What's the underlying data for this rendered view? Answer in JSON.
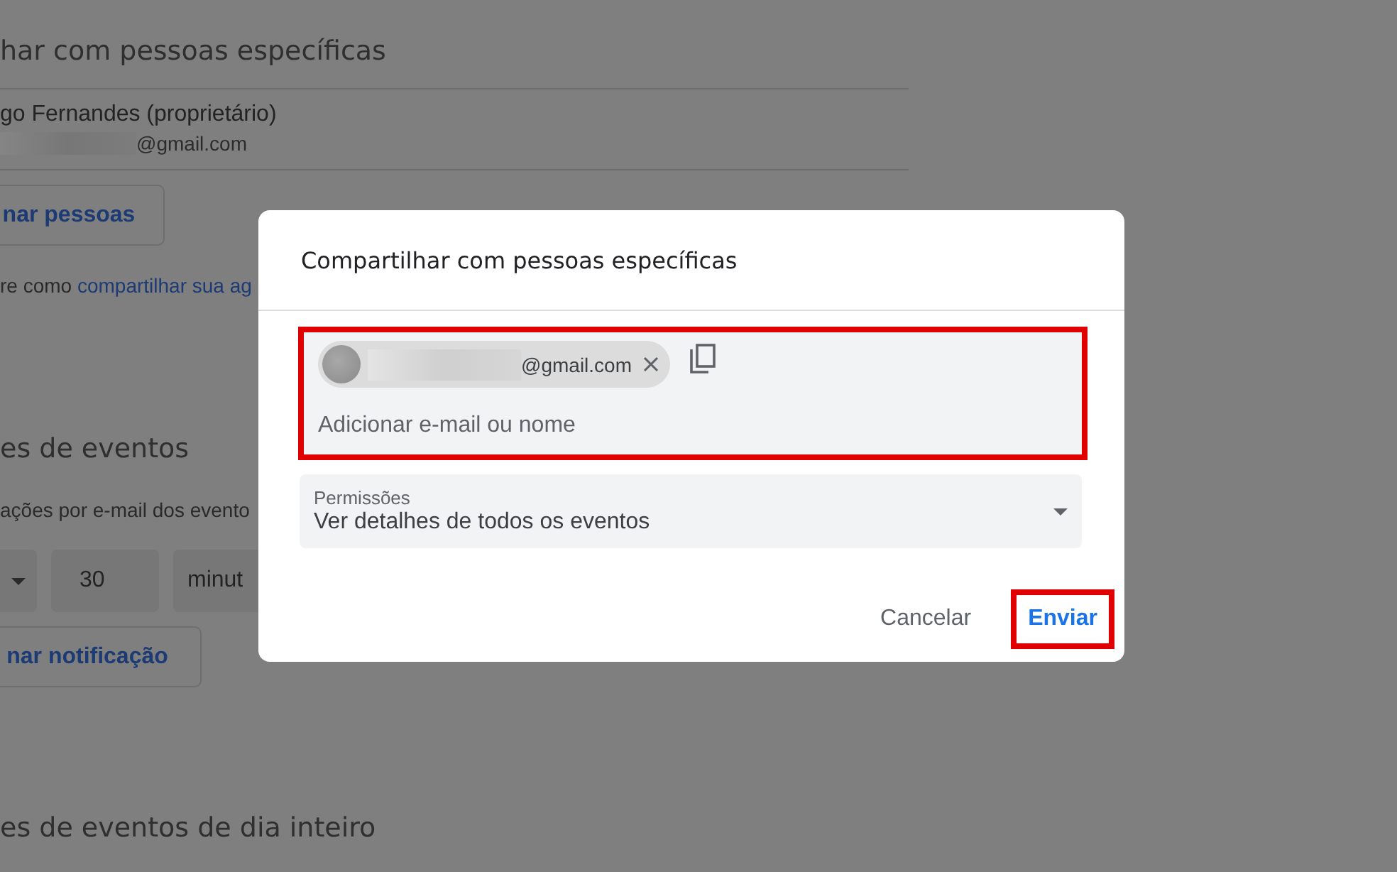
{
  "background_page": {
    "section_title": "har com pessoas específicas",
    "owner": {
      "name": "go Fernandes (proprietário)",
      "email": "@gmail.com"
    },
    "add_people_button": "nar pessoas",
    "help_text": "re como ",
    "help_link": "compartilhar sua ag",
    "events_title": "es de eventos",
    "events_text": "ações por e-mail dos evento",
    "notification": {
      "value": "30",
      "unit": "minut"
    },
    "add_notification_button": "nar notificação",
    "all_day_title": "es de eventos de dia inteiro"
  },
  "dialog": {
    "title": "Compartilhar com pessoas específicas",
    "recipients": [
      {
        "email": "@gmail.com"
      }
    ],
    "input": {
      "placeholder": "Adicionar e-mail ou nome",
      "highlighted": true
    },
    "permissions": {
      "label": "Permissões",
      "value": "Ver detalhes de todos os eventos"
    },
    "buttons": [
      {
        "label": "Cancelar",
        "kind": "secondary",
        "highlighted": false
      },
      {
        "label": "Enviar",
        "kind": "primary",
        "highlighted": true
      }
    ]
  }
}
